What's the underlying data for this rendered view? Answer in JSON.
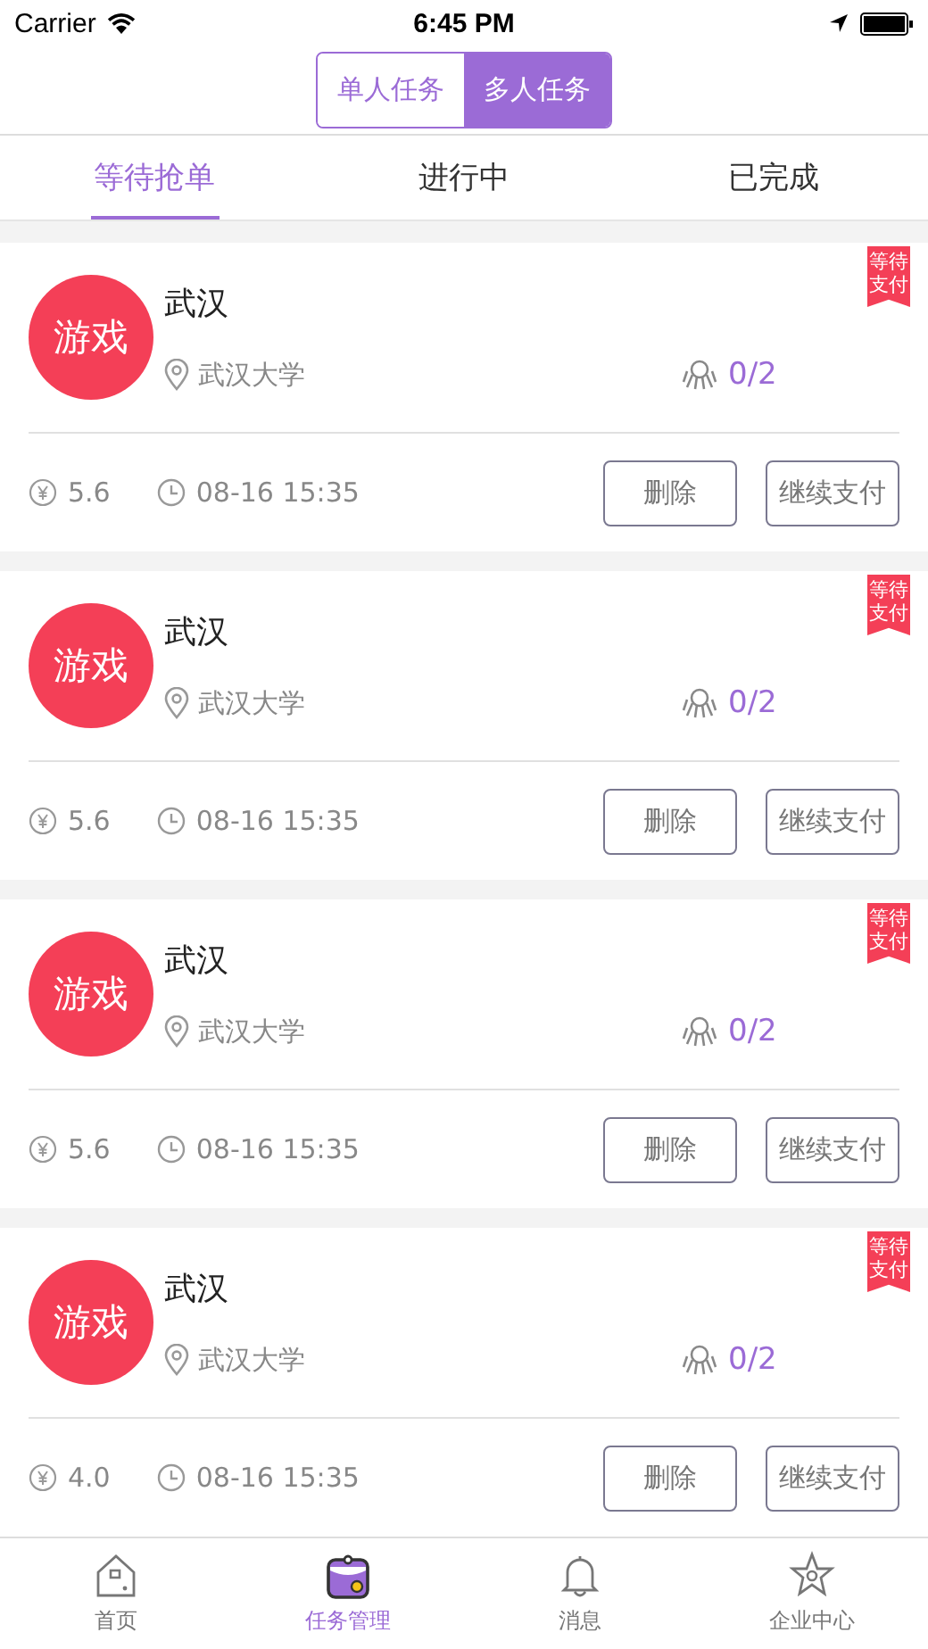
{
  "status_bar": {
    "carrier": "Carrier",
    "time": "6:45 PM"
  },
  "segments": [
    {
      "label": "单人任务",
      "selected": false
    },
    {
      "label": "多人任务",
      "selected": true
    }
  ],
  "tabs": [
    {
      "label": "等待抢单",
      "selected": true
    },
    {
      "label": "进行中",
      "selected": false
    },
    {
      "label": "已完成",
      "selected": false
    }
  ],
  "tasks": [
    {
      "category": "游戏",
      "title": "武汉",
      "location": "武汉大学",
      "participants": "0/2",
      "price": "5.6",
      "time": "08-16 15:35",
      "ribbon": "等待支付",
      "actions": [
        "删除",
        "继续支付"
      ]
    },
    {
      "category": "游戏",
      "title": "武汉",
      "location": "武汉大学",
      "participants": "0/2",
      "price": "5.6",
      "time": "08-16 15:35",
      "ribbon": "等待支付",
      "actions": [
        "删除",
        "继续支付"
      ]
    },
    {
      "category": "游戏",
      "title": "武汉",
      "location": "武汉大学",
      "participants": "0/2",
      "price": "5.6",
      "time": "08-16 15:35",
      "ribbon": "等待支付",
      "actions": [
        "删除",
        "继续支付"
      ]
    },
    {
      "category": "游戏",
      "title": "武汉",
      "location": "武汉大学",
      "participants": "0/2",
      "price": "4.0",
      "time": "08-16 15:35",
      "ribbon": "等待支付",
      "actions": [
        "删除",
        "继续支付"
      ]
    }
  ],
  "tab_bar": [
    {
      "kind": "home",
      "label": "首页",
      "selected": false
    },
    {
      "kind": "tasks",
      "label": "任务管理",
      "selected": true
    },
    {
      "kind": "bell",
      "label": "消息",
      "selected": false
    },
    {
      "kind": "star",
      "label": "企业中心",
      "selected": false
    }
  ]
}
